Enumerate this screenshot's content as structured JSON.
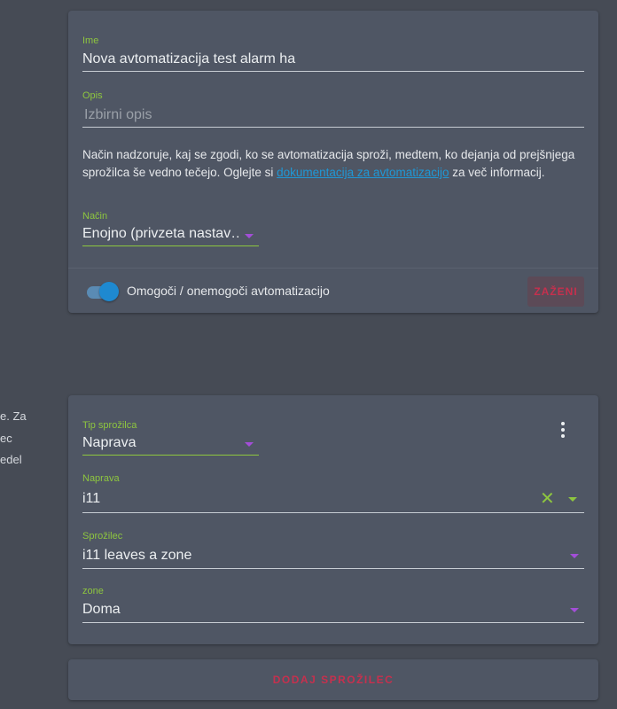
{
  "left_text": [
    "e. Za",
    "ec",
    "edel"
  ],
  "automation": {
    "name_label": "Ime",
    "name_value": "Nova avtomatizacija test alarm ha",
    "desc_label": "Opis",
    "desc_placeholder": "Izbirni opis",
    "mode_desc_before": "Način nadzoruje, kaj se zgodi, ko se avtomatizacija sproži, medtem, ko dejanja od prejšnjega sprožilca še vedno tečejo. Oglejte si ",
    "mode_desc_link": "dokumentacija za avtomatizacijo",
    "mode_desc_after": " za več informacij.",
    "mode_label": "Način",
    "mode_value": "Enojno (privzeta nastav…",
    "toggle_label": "Omogoči / onemogoči avtomatizacijo",
    "toggle_on": true,
    "run_button": "ZAŽENI"
  },
  "trigger": {
    "type_label": "Tip sprožilca",
    "type_value": "Naprava",
    "device_label": "Naprava",
    "device_value": "i11",
    "trigger_label": "Sprožilec",
    "trigger_value": "i11 leaves a zone",
    "zone_label": "zone",
    "zone_value": "Doma"
  },
  "add_trigger_button": "DODAJ SPROŽILEC",
  "colors": {
    "background": "#464b55",
    "card": "#4f5664",
    "accent_green": "#8ec63f",
    "accent_red": "#c6304e",
    "link_blue": "#1f98d6",
    "dropdown_purple": "#a34ed8"
  },
  "icons": {
    "dropdown": "triangle-down-icon",
    "menu": "vertical-dots-icon",
    "clear": "close-icon"
  }
}
